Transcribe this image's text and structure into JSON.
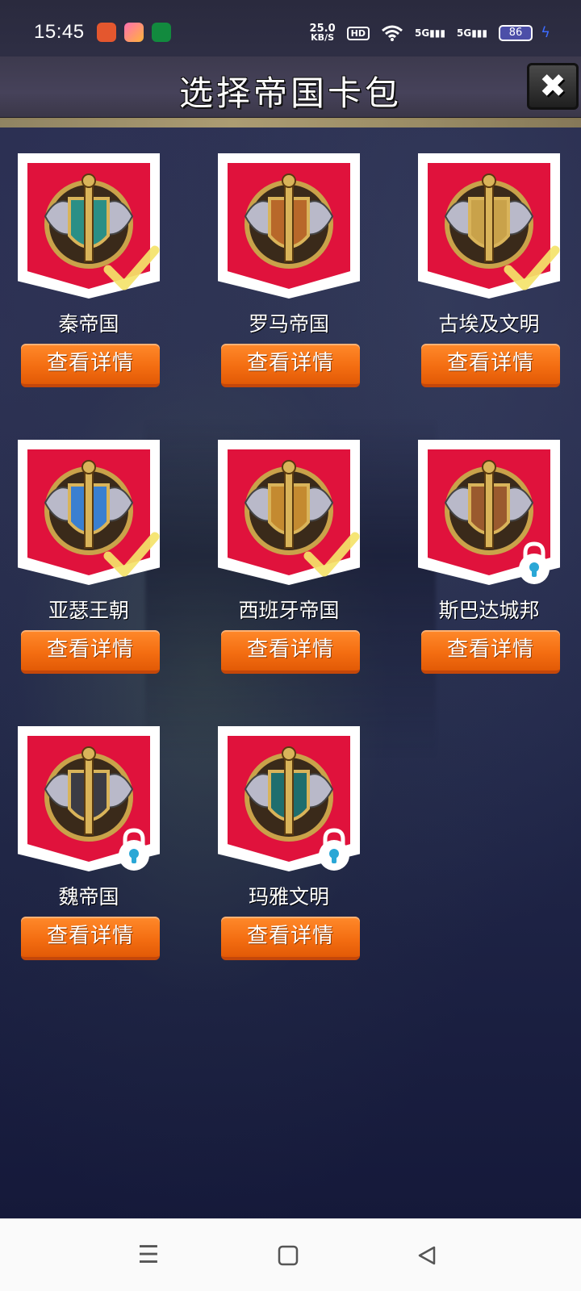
{
  "status_bar": {
    "time": "15:45",
    "net_speed_value": "25.0",
    "net_speed_unit": "KB/S",
    "hd_label": "HD",
    "signal_1": "5G",
    "signal_2": "5G",
    "battery": "86"
  },
  "header": {
    "title": "选择帝国卡包",
    "close_icon": "close-icon"
  },
  "cards": [
    {
      "name": "秦帝国",
      "button": "查看详情",
      "status": "selected",
      "emblem_color": "#2a8f86"
    },
    {
      "name": "罗马帝国",
      "button": "查看详情",
      "status": "available",
      "emblem_color": "#b8682a"
    },
    {
      "name": "古埃及文明",
      "button": "查看详情",
      "status": "selected",
      "emblem_color": "#c9a24a"
    },
    {
      "name": "亚瑟王朝",
      "button": "查看详情",
      "status": "selected",
      "emblem_color": "#3a7fd0"
    },
    {
      "name": "西班牙帝国",
      "button": "查看详情",
      "status": "selected",
      "emblem_color": "#c48a30"
    },
    {
      "name": "斯巴达城邦",
      "button": "查看详情",
      "status": "locked",
      "emblem_color": "#9a5a2e"
    },
    {
      "name": "魏帝国",
      "button": "查看详情",
      "status": "locked",
      "emblem_color": "#3c3c44"
    },
    {
      "name": "玛雅文明",
      "button": "查看详情",
      "status": "locked",
      "emblem_color": "#1f6e6e"
    }
  ],
  "colors": {
    "badge_red": "#e0123c",
    "button_orange": "#f46e12",
    "check_yellow": "#f4e36a",
    "lock_cyan": "#2aa7d6"
  },
  "nav_bar": {
    "menu_icon": "menu-icon",
    "home_icon": "home-icon",
    "back_icon": "back-icon"
  }
}
